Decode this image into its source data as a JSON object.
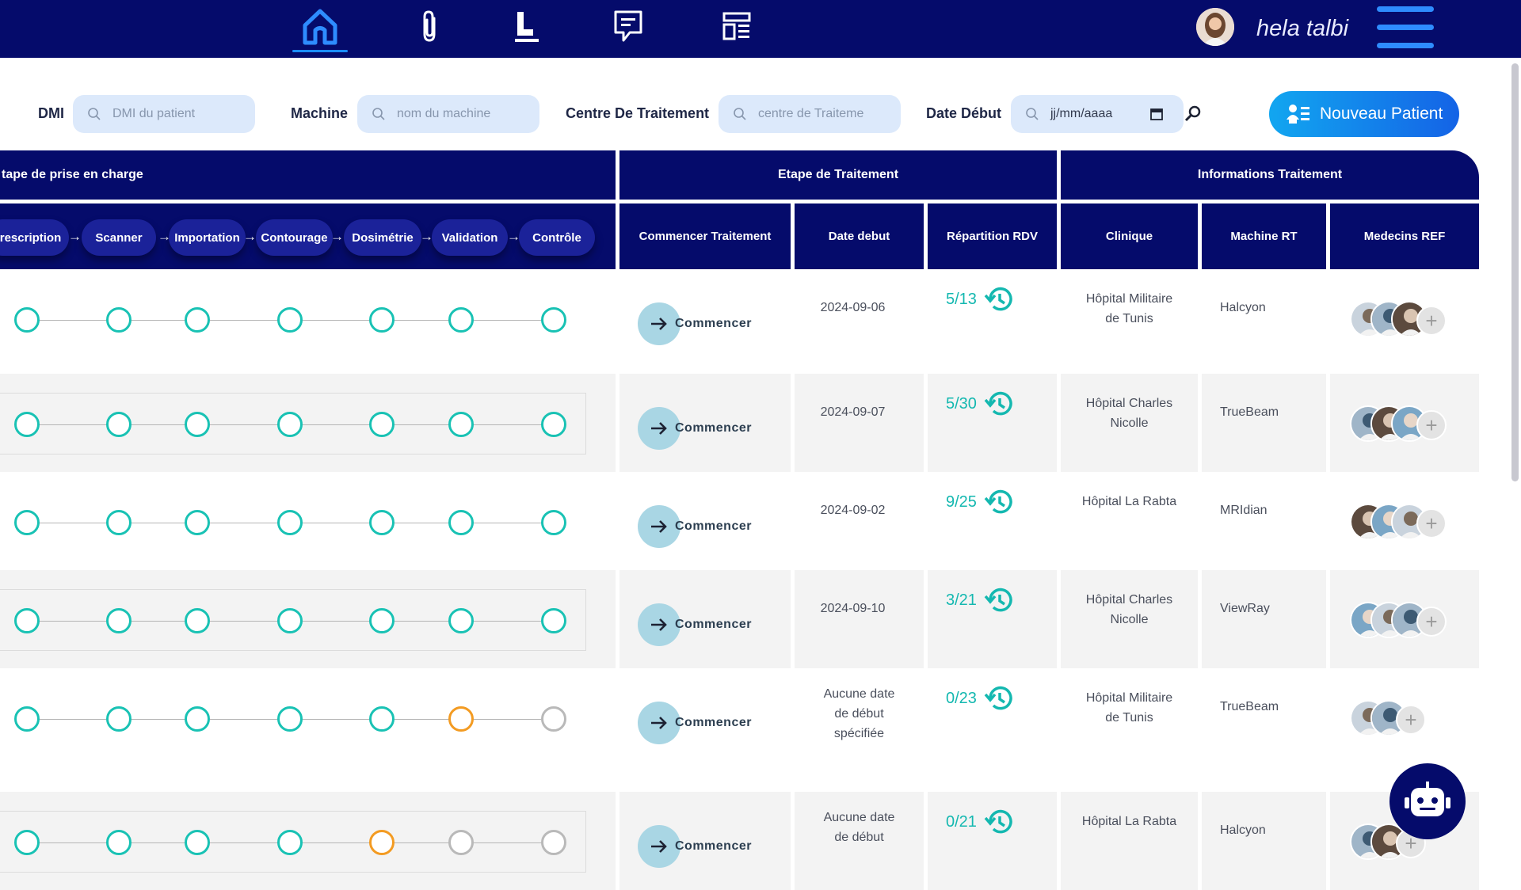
{
  "nav": {
    "icons": [
      "home-icon",
      "paperclip-icon",
      "chart-icon",
      "message-icon",
      "layout-icon"
    ],
    "active": "home-icon",
    "user_name": "hela talbi"
  },
  "filters": {
    "dmi_label": "DMI",
    "dmi_placeholder": "DMI du patient",
    "machine_label": "Machine",
    "machine_placeholder": "nom du machine",
    "centre_label": "Centre De Traitement",
    "centre_placeholder": "centre de Traiteme",
    "date_label": "Date Début",
    "date_placeholder": "jj/mm/aaaa",
    "new_patient_label": "Nouveau Patient"
  },
  "table": {
    "groups": {
      "prise": "tape de prise en charge",
      "traitement": "Etape de Traitement",
      "informations": "Informations Traitement"
    },
    "steps": [
      "Prescription",
      "Scanner",
      "Importation",
      "Contourage",
      "Dosimétrie",
      "Validation",
      "Contrôle"
    ],
    "columns": {
      "commencer": "Commencer Traitement",
      "date_debut": "Date debut",
      "repartition": "Répartition RDV",
      "clinique": "Clinique",
      "machine": "Machine RT",
      "medecins": "Medecins REF"
    },
    "start_label": "Commencer",
    "rows": [
      {
        "statuses": [
          "done",
          "done",
          "done",
          "done",
          "done",
          "done",
          "done"
        ],
        "date_lines": [
          "2024-09-06"
        ],
        "rdv": "5/13",
        "clinique_lines": [
          "Hôpital Militaire",
          "de Tunis"
        ],
        "machine": "Halcyon",
        "doctors": 3
      },
      {
        "statuses": [
          "done",
          "done",
          "done",
          "done",
          "done",
          "done",
          "done"
        ],
        "date_lines": [
          "2024-09-07"
        ],
        "rdv": "5/30",
        "clinique_lines": [
          "Hôpital Charles",
          "Nicolle"
        ],
        "machine": "TrueBeam",
        "doctors": 3
      },
      {
        "statuses": [
          "done",
          "done",
          "done",
          "done",
          "done",
          "done",
          "done"
        ],
        "date_lines": [
          "2024-09-02"
        ],
        "rdv": "9/25",
        "clinique_lines": [
          "Hôpital La Rabta"
        ],
        "machine": "MRIdian",
        "doctors": 3
      },
      {
        "statuses": [
          "done",
          "done",
          "done",
          "done",
          "done",
          "done",
          "done"
        ],
        "date_lines": [
          "2024-09-10"
        ],
        "rdv": "3/21",
        "clinique_lines": [
          "Hôpital Charles",
          "Nicolle"
        ],
        "machine": "ViewRay",
        "doctors": 3
      },
      {
        "statuses": [
          "done",
          "done",
          "done",
          "done",
          "done",
          "pending",
          "todo"
        ],
        "date_lines": [
          "Aucune date",
          "de début",
          "spécifiée"
        ],
        "rdv": "0/23",
        "clinique_lines": [
          "Hôpital Militaire",
          "de Tunis"
        ],
        "machine": "TrueBeam",
        "doctors": 2
      },
      {
        "statuses": [
          "done",
          "done",
          "done",
          "done",
          "pending",
          "todo",
          "todo"
        ],
        "date_lines": [
          "Aucune date",
          "de début"
        ],
        "rdv": "0/21",
        "clinique_lines": [
          "Hôpital La Rabta"
        ],
        "machine": "Halcyon",
        "doctors": 2
      }
    ]
  },
  "colors": {
    "navy": "#050b6b",
    "teal": "#19c2b4",
    "orange": "#f39b22",
    "gray": "#b9b9b9",
    "accent": "#1a8cff"
  },
  "chatbot": "robot-icon"
}
